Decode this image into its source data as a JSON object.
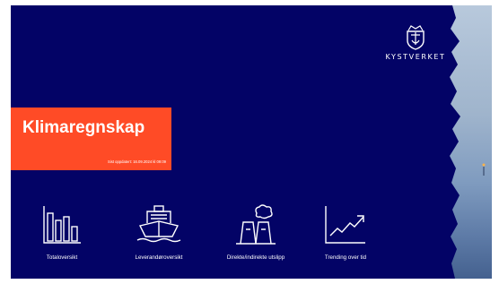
{
  "brand": {
    "name": "KYSTVERKET"
  },
  "header": {
    "title": "Klimaregnskap",
    "updated": "Sist oppdatert: 16.09.2024 kl 09:09"
  },
  "nav": [
    {
      "label": "Totaloversikt",
      "icon": "bar-chart-icon"
    },
    {
      "label": "Leverandøroversikt",
      "icon": "ship-icon"
    },
    {
      "label": "Direkte/indirekte utslipp",
      "icon": "factory-icon"
    },
    {
      "label": "Trending over tid",
      "icon": "trend-line-icon"
    }
  ],
  "colors": {
    "background": "#030366",
    "accent": "#ff4b26",
    "icon": "#ffffff"
  }
}
